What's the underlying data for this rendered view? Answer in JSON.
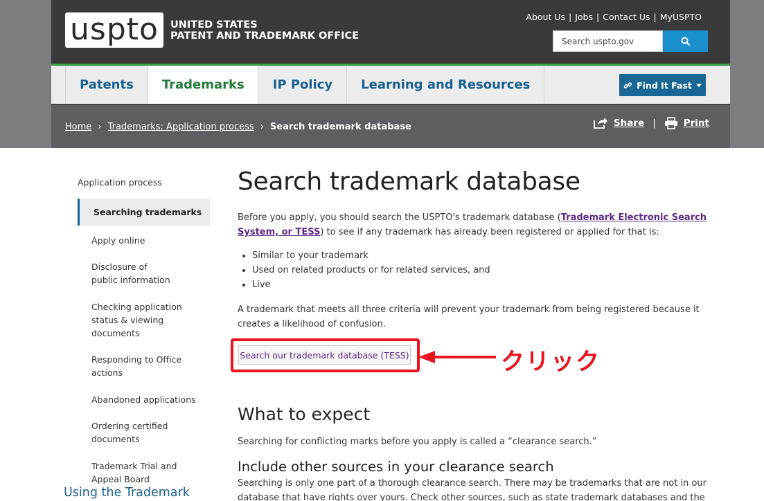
{
  "header": {
    "logo": "uspto",
    "org_line1": "UNITED STATES",
    "org_line2": "PATENT AND TRADEMARK OFFICE",
    "util_links": [
      "About Us",
      "Jobs",
      "Contact Us",
      "MyUSPTO"
    ],
    "search_placeholder": "Search uspto.gov"
  },
  "nav": {
    "items": [
      {
        "label": "Patents",
        "active": false
      },
      {
        "label": "Trademarks",
        "active": true
      },
      {
        "label": "IP Policy",
        "active": false
      },
      {
        "label": "Learning and Resources",
        "active": false
      }
    ],
    "find_it_fast": "Find It Fast"
  },
  "breadcrumb": {
    "home": "Home",
    "parent": "Trademarks: Application process",
    "current": "Search trademark database",
    "share": "Share",
    "print": "Print"
  },
  "sidenav": {
    "title": "Application process",
    "items": [
      {
        "label": "Searching trademarks",
        "active": true
      },
      {
        "label": "Apply online"
      },
      {
        "label": "Disclosure of public information"
      },
      {
        "label": "Checking application status & viewing documents"
      },
      {
        "label": "Responding to Office actions"
      },
      {
        "label": "Abandoned applications"
      },
      {
        "label": "Ordering certified documents"
      },
      {
        "label": "Trademark Trial and Appeal Board"
      }
    ],
    "bottom_heading": "Using the Trademark"
  },
  "main": {
    "title": "Search trademark database",
    "intro_before": "Before you apply, you should search the USPTO's trademark database (",
    "intro_link": "Trademark Electronic Search System, or TESS",
    "intro_after": ") to see if any trademark has already been registered or applied for that is:",
    "bullets": [
      "Similar to your trademark",
      "Used on related products or for related services, and",
      "Live"
    ],
    "criteria_text": "A trademark that meets all three criteria will prevent your trademark from being registered because it creates a likelihood of confusion.",
    "tess_button": "Search our trademark database (TESS)",
    "expect_heading": "What to expect",
    "expect_text": "Searching for conflicting marks before you apply is called a “clearance search.”",
    "sources_heading": "Include other sources in your clearance search",
    "sources_text": "Searching is only one part of a thorough clearance search. There may be trademarks that are not in our database that have rights over yours. Check other sources, such as state trademark databases and the internet."
  },
  "annotation": {
    "click_label": "クリック",
    "color": "#e8131c"
  },
  "colors": {
    "header_dark": "#3a3a3a",
    "nav_green": "#3d9f4e",
    "link_blue": "#1a5f8e",
    "link_purple": "#5b2a86",
    "search_blue": "#1a8fcd"
  }
}
